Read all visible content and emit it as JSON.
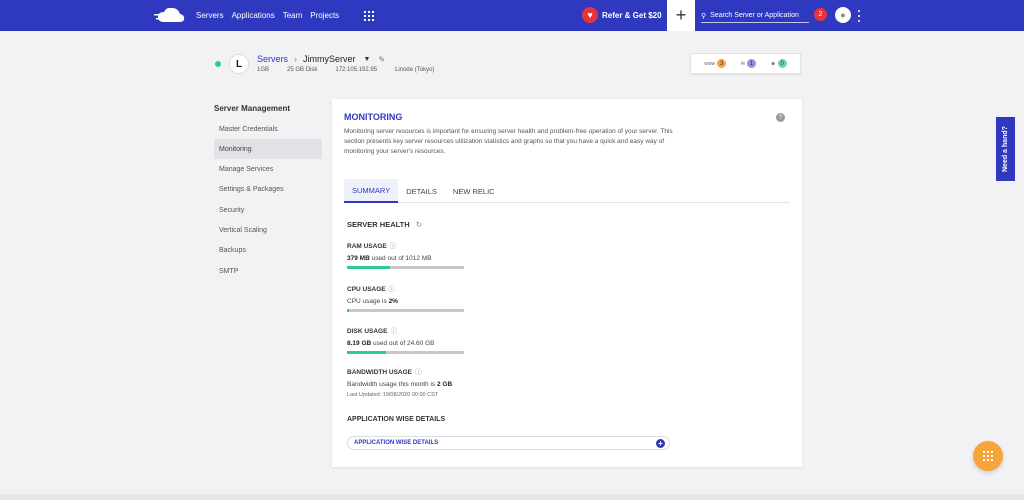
{
  "topbar": {
    "nav": [
      "Servers",
      "Applications",
      "Team",
      "Projects"
    ],
    "refer_label": "Refer & Get $20",
    "search_placeholder": "Search Server or Application",
    "notification_count": "2"
  },
  "server": {
    "breadcrumb_root": "Servers",
    "name": "JimmyServer",
    "ram": "1GB",
    "disk": "25 GB Disk",
    "ip": "172.105.192.95",
    "provider": "Linode (Tokyo)",
    "stats": [
      {
        "label": "www",
        "count": "3",
        "color": "#f4a640"
      },
      {
        "label": "mail",
        "count": "1",
        "color": "#8e95d8"
      },
      {
        "label": "user",
        "count": "0",
        "color": "#6ed6a5"
      }
    ]
  },
  "sidebar": {
    "title": "Server Management",
    "items": [
      "Master Credentials",
      "Monitoring",
      "Manage Services",
      "Settings & Packages",
      "Security",
      "Vertical Scaling",
      "Backups",
      "SMTP"
    ],
    "active_index": 1
  },
  "monitoring": {
    "title": "MONITORING",
    "description": "Monitoring server resources is important for ensuring server health and problem-free operation of your server. This section presents key server resources utilization statistics and graphs so that you have a quick and easy way of monitoring your server's resources.",
    "tabs": [
      "SUMMARY",
      "DETAILS",
      "NEW RELIC"
    ],
    "active_tab": 0,
    "health_title": "SERVER HEALTH",
    "ram": {
      "label": "RAM USAGE",
      "value": "379 MB",
      "suffix": "used out of 1012 MB",
      "fill": 0.37
    },
    "cpu": {
      "label": "CPU USAGE",
      "prefix": "CPU usage is",
      "value": "2%",
      "fill": 0.02
    },
    "disk": {
      "label": "DISK USAGE",
      "value": "8.19 GB",
      "suffix": "used out of 24.60 GB",
      "fill": 0.33
    },
    "bandwidth": {
      "label": "BANDWIDTH USAGE",
      "prefix": "Bandwidth usage this month is",
      "value": "2 GB",
      "updated": "Last Updated: 19/08/2020 00:00 CST"
    },
    "app_title": "APPLICATION WISE DETAILS",
    "app_button": "APPLICATION WISE DETAILS"
  },
  "help_tab": "Need a hand?",
  "colors": {
    "brand": "#2f39bf",
    "accent": "#2ecc8f",
    "alert": "#e8323c",
    "fab": "#f5a53a"
  }
}
